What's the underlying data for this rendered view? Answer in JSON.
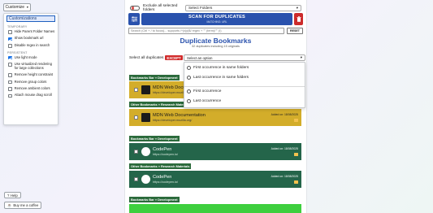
{
  "left": {
    "customize_label": "Customize",
    "panel_header": "Customizations",
    "sections": [
      {
        "label": "TEMPORARY",
        "options": [
          {
            "label": "Hide Parent Folder Names",
            "checked": false
          },
          {
            "label": "Show bookmark url",
            "checked": true
          },
          {
            "label": "Disable regex in search",
            "checked": false
          }
        ]
      },
      {
        "label": "PERSISTENT",
        "options": [
          {
            "label": "Use light mode",
            "checked": true
          },
          {
            "label": "Use virtualized rendering for large collections",
            "checked": false
          },
          {
            "label": "Remove height constraint",
            "checked": false
          },
          {
            "label": "Remove group colors",
            "checked": false
          },
          {
            "label": "Remove ambient colors",
            "checked": false
          },
          {
            "label": "Attach mouse drag scroll",
            "checked": false
          }
        ]
      }
    ],
    "help_label": "Help",
    "coffee_label": "Buy me a coffee"
  },
  "main": {
    "exclude_label": "Exclude all selected folders",
    "select_folders_label": "Select Folders",
    "scan_title": "SCAN FOR DUPLICATES",
    "scan_sub": "MATCHING: URL",
    "search_placeholder": "Search (Ctrl + / to focus)... supports /^(x|y)$/ regex + \"\" (term)/\"\" (!)",
    "reset_label": "RESET",
    "title": "Duplicate Bookmarks",
    "subtitle": "32 duplicates including 15 originals",
    "select_all_label": "Select all duplicates",
    "except_label": "EXCEPT",
    "select_option_label": "Select an option",
    "dropdown": [
      "First occurrence in same folders",
      "Last occurrence in same folders",
      "First occurrence",
      "Last occurrence"
    ],
    "groups": [
      {
        "header": "Bookmarks Bar » Development",
        "title": "MDN Web Documentation",
        "url": "https://developer.mozilla.org/",
        "added": "Added on: 18/08/2025",
        "color": "yellow"
      },
      {
        "header": "Other Bookmarks » Research Materials",
        "title": "MDN Web Documentation",
        "url": "https://developer.mozilla.org/",
        "added": "Added on: 18/08/2025",
        "color": "yellow"
      },
      {
        "header": "Bookmarks Bar » Development",
        "title": "CodePen",
        "url": "https://codepen.io/",
        "added": "Added on: 18/08/2025",
        "color": "green"
      },
      {
        "header": "Other Bookmarks » Research Materials",
        "title": "CodePen",
        "url": "https://codepen.io/",
        "added": "Added on: 18/08/2025",
        "color": "green"
      }
    ],
    "last_header": "Bookmarks Bar » Development"
  },
  "colors": {
    "accent": "#2a52ad",
    "danger": "#cc2b2b",
    "group_yellow": "#d3ad2a",
    "group_green": "#24654a",
    "header_green": "#2c6b3c",
    "strip_green": "#3ecf3e"
  },
  "icons": [
    "chevron-down-icon",
    "filter-icon",
    "trash-icon",
    "help-icon",
    "coffee-icon",
    "folder-icon",
    "favicon"
  ]
}
